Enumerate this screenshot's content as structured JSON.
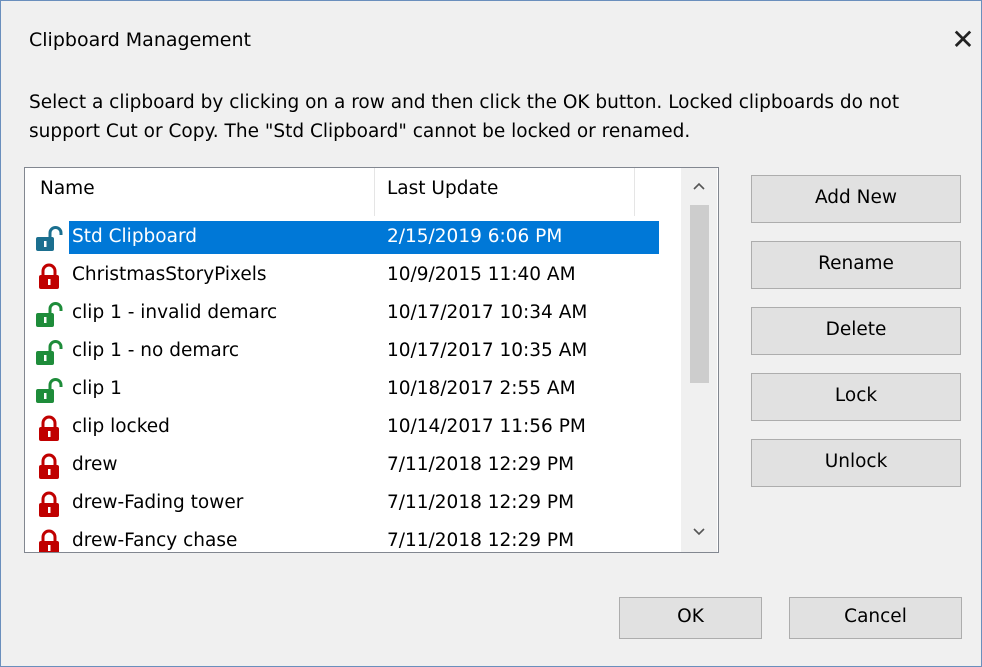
{
  "dialog": {
    "title": "Clipboard Management",
    "close_icon": "close-icon",
    "instructions": "Select a clipboard by clicking on a row and then click the OK button. Locked clipboards do not support Cut or Copy. The \"Std Clipboard\" cannot be locked or renamed."
  },
  "list": {
    "columns": [
      "Name",
      "Last Update"
    ],
    "rows": [
      {
        "name": "Std Clipboard",
        "date": "2/15/2019 6:06 PM",
        "lock": "unlocked",
        "selected": true
      },
      {
        "name": "ChristmasStoryPixels",
        "date": "10/9/2015 11:40 AM",
        "lock": "locked"
      },
      {
        "name": "clip 1 - invalid demarc",
        "date": "10/17/2017 10:34 AM",
        "lock": "unlocked"
      },
      {
        "name": "clip 1 - no demarc",
        "date": "10/17/2017 10:35 AM",
        "lock": "unlocked"
      },
      {
        "name": "clip 1",
        "date": "10/18/2017 2:55 AM",
        "lock": "unlocked"
      },
      {
        "name": "clip locked",
        "date": "10/14/2017 11:56 PM",
        "lock": "locked"
      },
      {
        "name": "drew",
        "date": "7/11/2018 12:29 PM",
        "lock": "locked"
      },
      {
        "name": "drew-Fading tower",
        "date": "7/11/2018 12:29 PM",
        "lock": "locked"
      },
      {
        "name": "drew-Fancy chase",
        "date": "7/11/2018 12:29 PM",
        "lock": "locked"
      }
    ],
    "scroll_up_icon": "chevron-up-icon",
    "scroll_down_icon": "chevron-down-icon"
  },
  "buttons": {
    "add_new": "Add New",
    "rename": "Rename",
    "delete": "Delete",
    "lock": "Lock",
    "unlock": "Unlock",
    "ok": "OK",
    "cancel": "Cancel"
  },
  "colors": {
    "selection": "#0078d7",
    "locked_icon": "#c00000",
    "unlocked_icon_green": "#1e8c3a",
    "unlocked_icon_selected": "#1b6f8f"
  }
}
